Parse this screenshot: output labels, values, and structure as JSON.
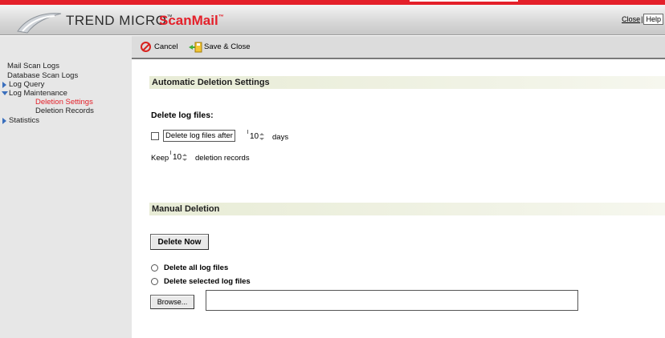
{
  "header": {
    "brand": "TREND MICRO",
    "brand_tm": "™",
    "product": "ScanMail",
    "product_tm": "™",
    "close_label": "Close",
    "separator": "|",
    "help_label": "Help"
  },
  "sidebar": {
    "items": [
      {
        "label": "Mail Scan Logs"
      },
      {
        "label": "Database Scan Logs"
      },
      {
        "label": "Log Query",
        "icon": "expand-arrow-icon"
      },
      {
        "label": "Log Maintenance",
        "icon": "collapse-arrow-icon"
      },
      {
        "label": "Deletion Settings",
        "active": true
      },
      {
        "label": "Deletion Records"
      },
      {
        "label": "Statistics",
        "icon": "expand-arrow-icon"
      }
    ]
  },
  "toolbar": {
    "cancel_label": "Cancel",
    "save_label": "Save & Close"
  },
  "auto_section": {
    "title": "Automatic Deletion Settings",
    "delete_log_files_heading": "Delete log files:",
    "delete_after_label": "Delete log files after",
    "days_value": "10",
    "days_unit": "days",
    "keep_label": "Keep",
    "keep_value": "10",
    "keep_suffix": "deletion records"
  },
  "manual_section": {
    "title": "Manual Deletion",
    "delete_now_label": "Delete Now",
    "radio_all_label": "Delete all log files",
    "radio_selected_label": "Delete selected log files",
    "browse_label": "Browse...",
    "file_path_value": ""
  },
  "colors": {
    "brand_red": "#e4202a",
    "section_bar": "#e8ecd6",
    "sidebar_bg": "#e7e7e7",
    "nav_arrow": "#3a6fbd"
  }
}
